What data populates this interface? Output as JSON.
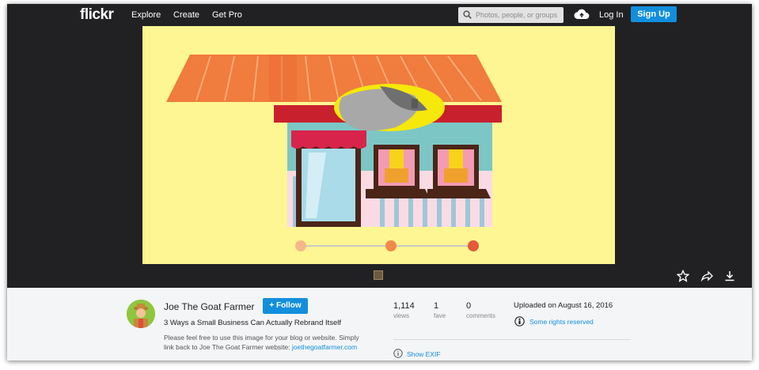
{
  "header": {
    "logo": "flickr",
    "nav": [
      {
        "label": "Explore"
      },
      {
        "label": "Create"
      },
      {
        "label": "Get Pro"
      }
    ],
    "search": {
      "placeholder": "Photos, people, or groups",
      "value": ""
    },
    "upload_icon": "cloud-upload-icon",
    "login": "Log In",
    "signup": "Sign Up"
  },
  "photo": {
    "subject": "storefront-illustration",
    "progress_steps": 3,
    "colors": {
      "background": "#fef693",
      "roof": "#f07c3d",
      "wall": "#7cc6c6",
      "awning": "#d8244a"
    }
  },
  "actions": [
    {
      "icon": "star-icon"
    },
    {
      "icon": "share-icon"
    },
    {
      "icon": "download-icon"
    }
  ],
  "info": {
    "author": "Joe The Goat Farmer",
    "follow_label": "Follow",
    "title": "3 Ways a Small Business Can Actually Rebrand Itself",
    "description_text": "Please feel free to use this image for your blog or website. Simply link back to Joe The Goat Farmer website:",
    "description_link": "joethegoatfarmer.com",
    "stats": [
      {
        "value": "1,114",
        "label": "views"
      },
      {
        "value": "1",
        "label": "fave"
      },
      {
        "value": "0",
        "label": "comments"
      }
    ],
    "uploaded": "Uploaded on August 16, 2016",
    "license": "Some rights reserved",
    "show_exif": "Show EXIF"
  },
  "colors": {
    "accent": "#128fdc",
    "bar": "#212124",
    "panel": "#f3f5f6"
  }
}
